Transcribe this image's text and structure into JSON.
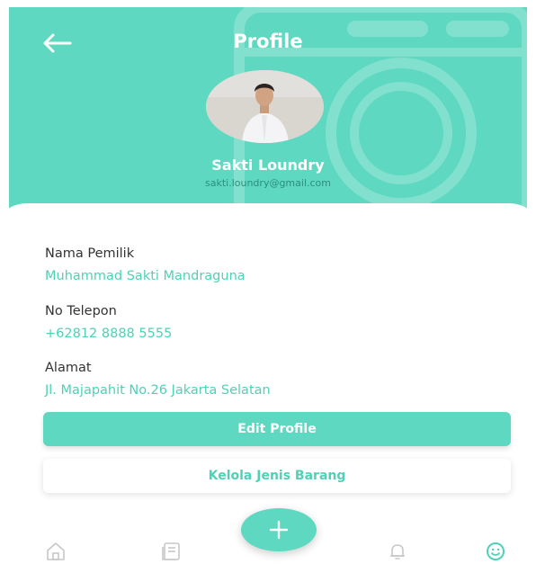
{
  "header": {
    "title": "Profile",
    "back_icon": "arrow-left-icon",
    "background_icon": "washing-machine-icon",
    "color": "#5ed8c0"
  },
  "profile": {
    "name": "Sakti Loundry",
    "email": "sakti.loundry@gmail.com"
  },
  "fields": [
    {
      "label": "Nama Pemilik",
      "value": "Muhammad Sakti Mandraguna"
    },
    {
      "label": "No Telepon",
      "value": "+62812 8888 5555"
    },
    {
      "label": "Alamat",
      "value": "Jl. Majapahit No.26 Jakarta Selatan"
    }
  ],
  "buttons": {
    "edit_profile": "Edit Profile",
    "manage_items": "Kelola Jenis Barang"
  },
  "nav": {
    "items": [
      {
        "icon": "home-icon",
        "active": false
      },
      {
        "icon": "orders-icon",
        "active": false
      },
      {
        "icon": "add-icon",
        "active": false
      },
      {
        "icon": "bell-icon",
        "active": false
      },
      {
        "icon": "smiley-icon",
        "active": true
      }
    ],
    "accent": "#4fd1b6",
    "inactive": "#c7c7c7"
  }
}
